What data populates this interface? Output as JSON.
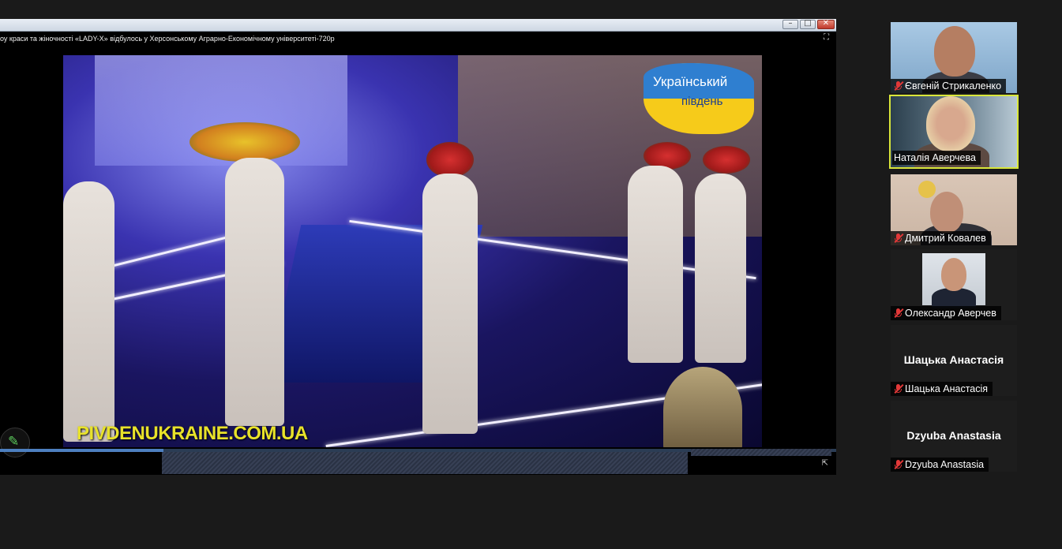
{
  "share": {
    "video_title": "оу краси та жіночності «LADY-X» відбулось у Херсонському Аграрно-Економічному університеті-720р",
    "window_buttons": {
      "minimize": "–",
      "maximize": "□",
      "close": "✕"
    },
    "fullscreen_glyph": "⛶",
    "popout_glyph": "⇱",
    "channel_logo": {
      "line1": "Український",
      "line2": "південь"
    },
    "watermark": "PIVDENUKRAINE.COM.UA",
    "progress": 0.195,
    "icons": {
      "annotate": "pencil-icon",
      "annotate_glyph": "✎"
    }
  },
  "colors": {
    "active_speaker": "#d9e63a",
    "muted": "#e23838",
    "watermark": "#e8e22a"
  },
  "participants": [
    {
      "name": "Євгеній Стрикаленко",
      "muted": true,
      "video": true,
      "active": false
    },
    {
      "name": "Наталія Аверчева",
      "muted": false,
      "video": true,
      "active": true
    },
    {
      "name": "Дмитрий Ковалев",
      "muted": true,
      "video": true,
      "active": false
    },
    {
      "name": "Олександр Аверчев",
      "muted": true,
      "video": true,
      "active": false
    },
    {
      "name": "Шацька Анастасія",
      "display": "Шацька Анастасія",
      "muted": true,
      "video": false,
      "active": false
    },
    {
      "name": "Dzyuba Anastasia",
      "display": "Dzyuba Anastasia",
      "muted": true,
      "video": false,
      "active": false
    }
  ]
}
